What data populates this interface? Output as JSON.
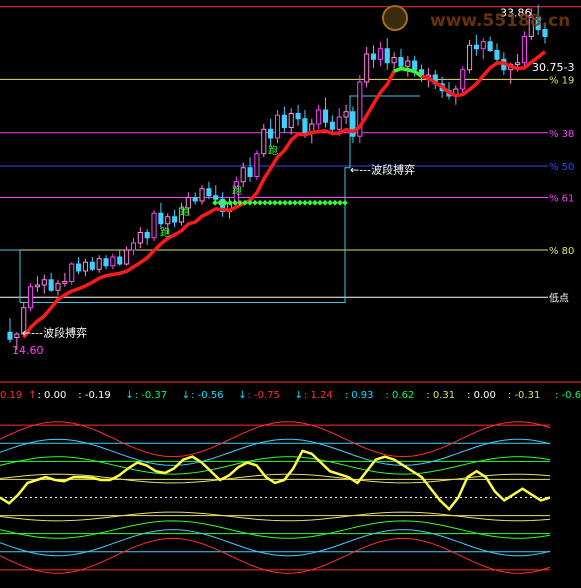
{
  "watermark": "www.55188.cn",
  "price_panel": {
    "price_labels": [
      {
        "text": "33.86",
        "y": 33.86
      },
      {
        "text": "30.75-3",
        "y": 30.75
      }
    ],
    "fib_lines": [
      {
        "label": "% 19",
        "price": 30.05,
        "color": "#e6e06a"
      },
      {
        "label": "% 38",
        "price": 27.0,
        "color": "#ff3cff"
      },
      {
        "label": "% 50",
        "price": 25.1,
        "color": "#3048ff"
      },
      {
        "label": "% 61",
        "price": 23.3,
        "color": "#ff3cff"
      },
      {
        "label": "% 80",
        "price": 20.3,
        "color": "#e6e06a"
      },
      {
        "label": "低点",
        "price": 17.6,
        "color": "#ffffff"
      }
    ],
    "top_line_price": 34.2,
    "annotations": [
      {
        "text": "←---波段搏弈",
        "price": 24.9
      },
      {
        "text": "←---波段搏弈",
        "price": 15.6
      },
      {
        "text": "14.60",
        "price": 14.6
      }
    ],
    "run_labels": [
      "跑",
      "跑",
      "跑",
      "跑"
    ],
    "ylim": [
      14.3,
      34.3
    ]
  },
  "indicator_bar": {
    "values": [
      {
        "text": "0.19",
        "color": "#ff3030"
      },
      {
        "text": "↑",
        "color": "#ff3030"
      },
      {
        "text": ": 0.00",
        "color": "#ffffff"
      },
      {
        "text": ": -0.19",
        "color": "#ffffff"
      },
      {
        "text": "↓",
        "color": "#00e0ff"
      },
      {
        "text": ": -0.37",
        "color": "#00ff60"
      },
      {
        "text": "↓",
        "color": "#00e0ff"
      },
      {
        "text": ": -0.56",
        "color": "#00e0ff"
      },
      {
        "text": "↓",
        "color": "#00e0ff"
      },
      {
        "text": ": -0.75",
        "color": "#ff3030"
      },
      {
        "text": "↓",
        "color": "#00e0ff"
      },
      {
        "text": ": 1.24",
        "color": "#ff3030"
      },
      {
        "text": ": 0.93",
        "color": "#00e0ff"
      },
      {
        "text": ": 0.62",
        "color": "#00ff60"
      },
      {
        "text": ": 0.31",
        "color": "#e6e06a"
      },
      {
        "text": ": 0.00",
        "color": "#ffffff"
      },
      {
        "text": ": -0.31",
        "color": "#e6e06a"
      },
      {
        "text": ": -0.62",
        "color": "#00ff60"
      },
      {
        "text": ": -0",
        "color": "#00e0ff"
      }
    ]
  },
  "chart_data": {
    "type": "candlestick",
    "candles": [
      [
        15.6,
        16.4,
        15.0,
        15.2
      ],
      [
        15.3,
        15.6,
        14.6,
        15.5
      ],
      [
        15.5,
        17.3,
        15.3,
        17.0
      ],
      [
        17.0,
        18.4,
        16.8,
        18.2
      ],
      [
        18.2,
        18.8,
        17.9,
        18.3
      ],
      [
        18.3,
        18.9,
        17.8,
        18.6
      ],
      [
        18.6,
        19.0,
        17.9,
        18.0
      ],
      [
        18.0,
        18.6,
        17.7,
        18.4
      ],
      [
        18.4,
        19.0,
        18.2,
        18.5
      ],
      [
        18.5,
        19.6,
        18.3,
        19.5
      ],
      [
        19.5,
        19.9,
        18.9,
        19.1
      ],
      [
        19.1,
        19.8,
        18.8,
        19.6
      ],
      [
        19.6,
        19.9,
        19.1,
        19.2
      ],
      [
        19.2,
        20.0,
        19.0,
        19.8
      ],
      [
        19.8,
        20.0,
        19.2,
        19.4
      ],
      [
        19.4,
        20.1,
        19.2,
        19.9
      ],
      [
        19.9,
        20.3,
        19.4,
        19.5
      ],
      [
        19.5,
        20.5,
        19.4,
        20.3
      ],
      [
        20.3,
        21.0,
        20.0,
        20.7
      ],
      [
        20.7,
        21.6,
        20.4,
        21.3
      ],
      [
        21.3,
        21.5,
        20.6,
        21.0
      ],
      [
        21.0,
        22.6,
        20.8,
        22.4
      ],
      [
        22.4,
        23.0,
        21.5,
        21.8
      ],
      [
        21.8,
        22.4,
        21.2,
        22.2
      ],
      [
        22.2,
        22.6,
        21.6,
        21.9
      ],
      [
        21.9,
        23.0,
        21.7,
        22.7
      ],
      [
        22.7,
        23.6,
        22.3,
        23.3
      ],
      [
        23.3,
        23.6,
        22.9,
        23.1
      ],
      [
        23.1,
        24.0,
        22.9,
        23.8
      ],
      [
        23.8,
        24.2,
        23.2,
        23.4
      ],
      [
        23.4,
        24.0,
        22.9,
        23.2
      ],
      [
        23.2,
        23.6,
        22.2,
        22.5
      ],
      [
        22.5,
        23.3,
        22.1,
        23.0
      ],
      [
        23.0,
        24.5,
        22.7,
        24.2
      ],
      [
        24.2,
        25.3,
        23.9,
        25.0
      ],
      [
        25.0,
        25.6,
        24.2,
        24.5
      ],
      [
        24.5,
        26.0,
        24.3,
        25.8
      ],
      [
        25.8,
        27.5,
        25.6,
        27.2
      ],
      [
        27.2,
        27.8,
        26.2,
        26.7
      ],
      [
        26.7,
        28.3,
        26.4,
        28.0
      ],
      [
        28.0,
        28.5,
        27.0,
        27.3
      ],
      [
        27.3,
        28.4,
        26.9,
        28.1
      ],
      [
        28.1,
        28.6,
        27.4,
        27.8
      ],
      [
        27.8,
        28.3,
        26.7,
        27.0
      ],
      [
        27.0,
        27.8,
        26.4,
        27.5
      ],
      [
        27.5,
        28.6,
        27.2,
        28.3
      ],
      [
        28.3,
        29.0,
        27.3,
        27.6
      ],
      [
        27.6,
        28.0,
        26.9,
        27.2
      ],
      [
        27.2,
        28.4,
        26.8,
        27.9
      ],
      [
        27.9,
        28.6,
        27.5,
        28.2
      ],
      [
        28.2,
        28.5,
        26.4,
        26.8
      ],
      [
        26.8,
        30.3,
        26.4,
        29.9
      ],
      [
        29.9,
        31.9,
        29.6,
        31.5
      ],
      [
        31.5,
        32.0,
        30.7,
        31.2
      ],
      [
        31.2,
        32.2,
        30.8,
        31.8
      ],
      [
        31.8,
        32.4,
        30.6,
        31.0
      ],
      [
        31.0,
        31.6,
        30.4,
        31.3
      ],
      [
        31.3,
        31.8,
        30.6,
        30.8
      ],
      [
        30.8,
        31.4,
        30.2,
        31.1
      ],
      [
        31.1,
        31.4,
        30.2,
        30.6
      ],
      [
        30.6,
        30.9,
        29.9,
        30.2
      ],
      [
        30.2,
        30.7,
        29.6,
        30.3
      ],
      [
        30.3,
        30.6,
        29.5,
        29.8
      ],
      [
        29.8,
        30.2,
        29.0,
        29.4
      ],
      [
        29.4,
        29.9,
        28.9,
        29.1
      ],
      [
        29.1,
        29.7,
        28.6,
        29.5
      ],
      [
        29.5,
        30.8,
        29.2,
        30.6
      ],
      [
        30.6,
        32.3,
        30.4,
        32.0
      ],
      [
        32.0,
        32.6,
        31.4,
        31.8
      ],
      [
        31.8,
        32.4,
        31.2,
        32.2
      ],
      [
        32.2,
        32.5,
        31.6,
        31.7
      ],
      [
        31.7,
        32.1,
        30.9,
        31.2
      ],
      [
        31.2,
        31.6,
        30.3,
        30.6
      ],
      [
        30.6,
        31.0,
        29.8,
        30.9
      ],
      [
        30.9,
        31.5,
        30.5,
        31.0
      ],
      [
        31.0,
        32.8,
        30.6,
        32.5
      ],
      [
        32.5,
        34.1,
        32.3,
        33.6
      ],
      [
        33.6,
        34.3,
        32.6,
        32.9
      ],
      [
        32.9,
        33.3,
        32.1,
        32.5
      ]
    ],
    "ma_line_price_fit": "red ascending moving average",
    "oscillator": {
      "yellow_line": [
        0.0,
        -0.1,
        0.05,
        0.25,
        0.3,
        0.35,
        0.3,
        0.28,
        0.35,
        0.35,
        0.34,
        0.3,
        0.3,
        0.38,
        0.5,
        0.6,
        0.55,
        0.45,
        0.42,
        0.5,
        0.65,
        0.7,
        0.6,
        0.45,
        0.3,
        0.38,
        0.52,
        0.6,
        0.55,
        0.35,
        0.25,
        0.3,
        0.5,
        0.8,
        0.75,
        0.6,
        0.45,
        0.4,
        0.35,
        0.25,
        0.45,
        0.65,
        0.7,
        0.65,
        0.55,
        0.45,
        0.35,
        0.15,
        -0.05,
        -0.2,
        0.0,
        0.35,
        0.45,
        0.35,
        0.1,
        -0.05,
        0.05,
        0.15,
        0.05,
        -0.05,
        0.0
      ],
      "levels": [
        1.24,
        0.93,
        0.62,
        0.31,
        0.0,
        -0.31,
        -0.62,
        -0.93,
        -1.24
      ],
      "ylim": [
        -1.5,
        1.5
      ]
    }
  }
}
